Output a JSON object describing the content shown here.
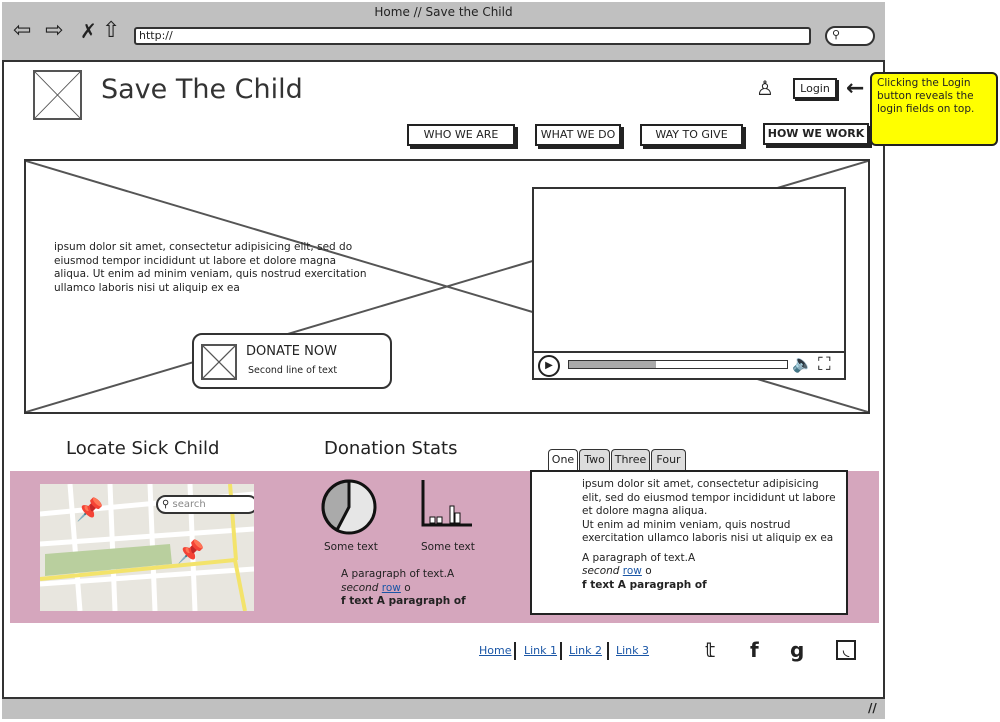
{
  "browser": {
    "title": "Home // Save the Child",
    "url": "http://",
    "icons": [
      "back-arrow-icon",
      "forward-arrow-icon",
      "stop-x-icon",
      "home-icon",
      "search-icon"
    ]
  },
  "header": {
    "site_title": "Save The Child",
    "login_label": "Login"
  },
  "nav": [
    "WHO WE ARE",
    "WHAT WE DO",
    "WAY TO GIVE",
    "HOW WE WORK"
  ],
  "annotation": "Clicking the Login button reveals the login fields on top.",
  "hero": {
    "text": " ipsum dolor sit amet, consectetur adipisicing elit, sed do eiusmod tempor incididunt ut labore et dolore magna aliqua. Ut enim ad minim veniam, quis nostrud exercitation ullamco laboris nisi ut aliquip ex ea",
    "donate_title": "DONATE NOW",
    "donate_sub": "Second line of text"
  },
  "sections": {
    "locate": "Locate Sick Child",
    "stats": "Donation Stats"
  },
  "map": {
    "search_placeholder": "search"
  },
  "stats": {
    "caption1": "Some text",
    "caption2": "Some text",
    "para1": "A paragraph of text.A ",
    "para_italic": "second",
    "para_link": "row",
    "para2": " o",
    "para3": "f text A paragraph of"
  },
  "tabs": {
    "items": [
      "One",
      "Two",
      "Three",
      "Four"
    ],
    "content": " ipsum dolor sit amet, consectetur adipisicing elit, sed do eiusmod tempor incididunt ut labore et dolore magna aliqua.",
    "content2": "Ut enim ad minim veniam, quis nostrud exercitation ullamco laboris nisi ut aliquip ex ea",
    "para1": "A paragraph of text.A",
    "para_italic": "second",
    "para_link": "row",
    "para2": " o",
    "para3": "f text A paragraph of"
  },
  "footer": {
    "links": [
      "Home",
      "Link 1",
      "Link 2",
      "Link 3"
    ],
    "social": [
      "twitter-icon",
      "facebook-icon",
      "google-icon",
      "rss-icon"
    ]
  },
  "colors": {
    "chrome": "#c0c0c0",
    "band": "#d5a6bd",
    "note": "#ffff00",
    "link": "#1a56a6"
  }
}
